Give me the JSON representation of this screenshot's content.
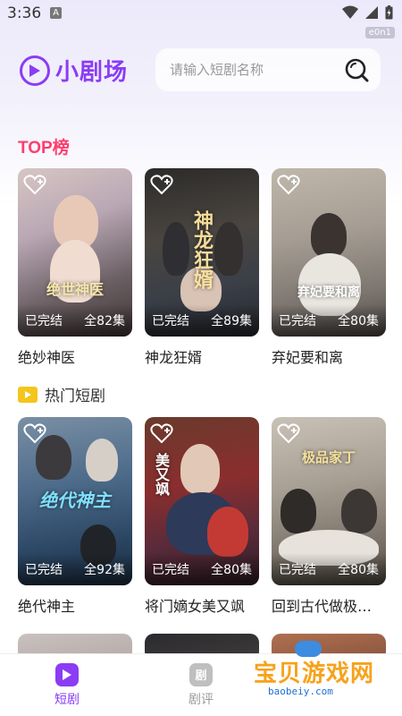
{
  "status_bar": {
    "time": "3:36",
    "notification_letter": "A",
    "tag": "e0n1"
  },
  "header": {
    "app_name": "小剧场",
    "search_placeholder": "请输入短剧名称"
  },
  "top_section": {
    "title": "TOP榜",
    "items": [
      {
        "title": "绝妙神医",
        "status": "已完结",
        "episodes": "全82集",
        "art": "绝世神医"
      },
      {
        "title": "神龙狂婿",
        "status": "已完结",
        "episodes": "全89集",
        "art": "神龙狂婿"
      },
      {
        "title": "弃妃要和离",
        "status": "已完结",
        "episodes": "全80集",
        "art": "弃妃要和离"
      }
    ]
  },
  "hot_section": {
    "title": "热门短剧",
    "items": [
      {
        "title": "绝代神主",
        "status": "已完结",
        "episodes": "全92集",
        "art": "绝代神主"
      },
      {
        "title": "将门嫡女美又飒",
        "status": "已完结",
        "episodes": "全80集",
        "art": "美又飒"
      },
      {
        "title": "回到古代做极品家丁",
        "status": "已完结",
        "episodes": "全80集",
        "art": "极品家丁"
      }
    ]
  },
  "bottom_nav": {
    "items": [
      {
        "label": "短剧",
        "icon": "play-icon",
        "active": true
      },
      {
        "label": "剧评",
        "icon_text": "剧",
        "icon": "review-icon",
        "active": false
      }
    ]
  },
  "watermark": {
    "text": "宝贝游戏网",
    "sub": "baobeiy.com"
  },
  "colors": {
    "brand": "#8b3cf5",
    "top_title": "#ff3d6e",
    "hot_icon": "#f5c51c"
  }
}
